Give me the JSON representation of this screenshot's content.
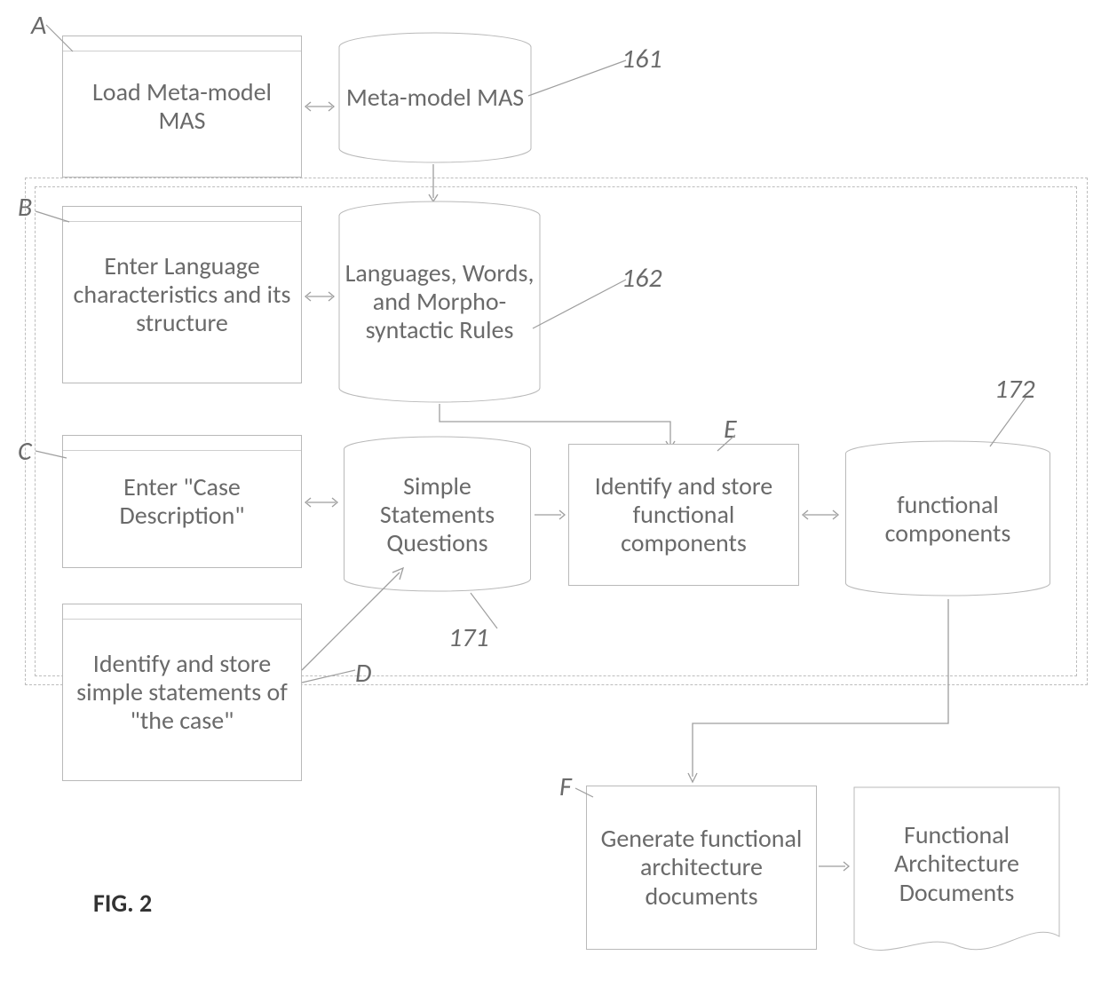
{
  "figure": "FIG. 2",
  "boxes": {
    "A": "Load  Meta-model MAS",
    "B": "Enter Language characteristics and its structure",
    "C": "Enter \"Case Description\"",
    "D": "Identify and store simple statements of \"the case\"",
    "E": "Identify and store functional components",
    "F": "Generate functional architecture documents"
  },
  "cylinders": {
    "metaModel": "Meta-model MAS",
    "languages": "Languages, Words, and Morpho-syntactic Rules",
    "simpleStatements": "Simple Statements Questions",
    "functionalComponents": "functional components"
  },
  "docs": {
    "functionalArch": "Functional Architecture Documents"
  },
  "refs": {
    "metaModel": "161",
    "languages": "162",
    "simpleStatements": "171",
    "functionalComponents": "172"
  },
  "letters": {
    "A": "A",
    "B": "B",
    "C": "C",
    "D": "D",
    "E": "E",
    "F": "F"
  }
}
